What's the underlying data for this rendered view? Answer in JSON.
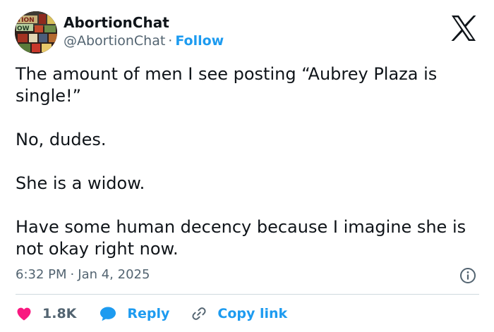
{
  "account": {
    "name": "AbortionChat",
    "handle": "@AbortionChat",
    "separator": "·",
    "follow_label": "Follow",
    "avatar_text_top": "TION",
    "avatar_text_bottom": "OW"
  },
  "tweet": {
    "paragraphs": [
      "The amount of men I see posting “Aubrey Plaza is single!”",
      "No, dudes.",
      "She is a widow.",
      "Have some human decency because I imagine she is not okay right now."
    ],
    "time": "6:32 PM",
    "date_separator": "·",
    "date": "Jan 4, 2025"
  },
  "actions": {
    "likes_count": "1.8K",
    "reply_label": "Reply",
    "copy_link_label": "Copy link"
  },
  "icons": {
    "platform_logo": "x-logo-icon",
    "info": "info-icon",
    "like": "heart-icon",
    "reply": "speech-bubble-icon",
    "copy_link": "link-icon"
  },
  "colors": {
    "text": "#0f1419",
    "secondary": "#536471",
    "accent_blue": "#1d9bf0",
    "like_pink": "#f91880",
    "divider": "#cfd9de"
  }
}
